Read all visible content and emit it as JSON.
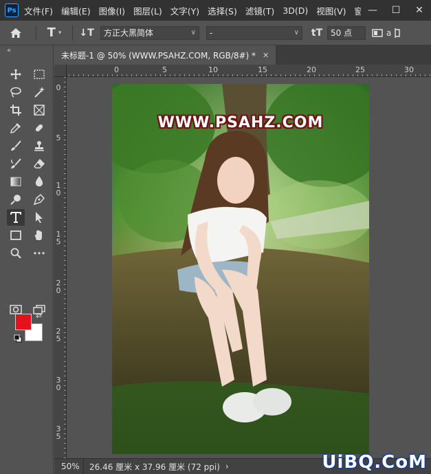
{
  "app": {
    "logo": "Ps"
  },
  "menu": {
    "items": [
      "文件(F)",
      "编辑(E)",
      "图像(I)",
      "图层(L)",
      "文字(Y)",
      "选择(S)",
      "滤镜(T)",
      "3D(D)",
      "视图(V)",
      "窗口(W"
    ],
    "window_controls": {
      "minimize": "—",
      "maximize": "☐",
      "close": "✕"
    }
  },
  "options": {
    "home_icon": "home-icon",
    "type_tool_icon": "T",
    "orientation_icon": "↓T",
    "font_family": "方正大黑简体",
    "font_style": "-",
    "size_icon": "tT",
    "font_size": "50 点",
    "aa_label": "a"
  },
  "tab": {
    "title": "未标题-1 @ 50% (WWW.PSAHZ.COM, RGB/8#) *",
    "close": "✕"
  },
  "ruler": {
    "h_labels": [
      "0",
      "0",
      "5",
      "10",
      "15",
      "20",
      "25",
      "30"
    ],
    "v_labels": [
      "0",
      "5",
      "1\n0",
      "1\n5",
      "2\n0",
      "2\n5",
      "3\n0",
      "3\n5"
    ]
  },
  "canvas": {
    "watermark_text": "WWW.PSAHZ.COM"
  },
  "colors": {
    "foreground": "#e3121c",
    "background": "#ffffff",
    "watermark_stroke": "#6b1413"
  },
  "status": {
    "zoom": "50%",
    "doc_info": "26.46 厘米 x 37.96 厘米 (72 ppi)",
    "arrow": "›"
  },
  "brand_overlay": "UiBQ.CoM",
  "tools": [
    "move-icon",
    "marquee-icon",
    "lasso-icon",
    "magic-wand-icon",
    "crop-icon",
    "frame-icon",
    "eyedropper-icon",
    "healing-icon",
    "brush-icon",
    "stamp-icon",
    "history-brush-icon",
    "eraser-icon",
    "gradient-icon",
    "blur-icon",
    "dodge-icon",
    "pen-icon",
    "type-icon",
    "path-select-icon",
    "rectangle-icon",
    "hand-icon",
    "zoom-icon",
    "more-icon"
  ]
}
